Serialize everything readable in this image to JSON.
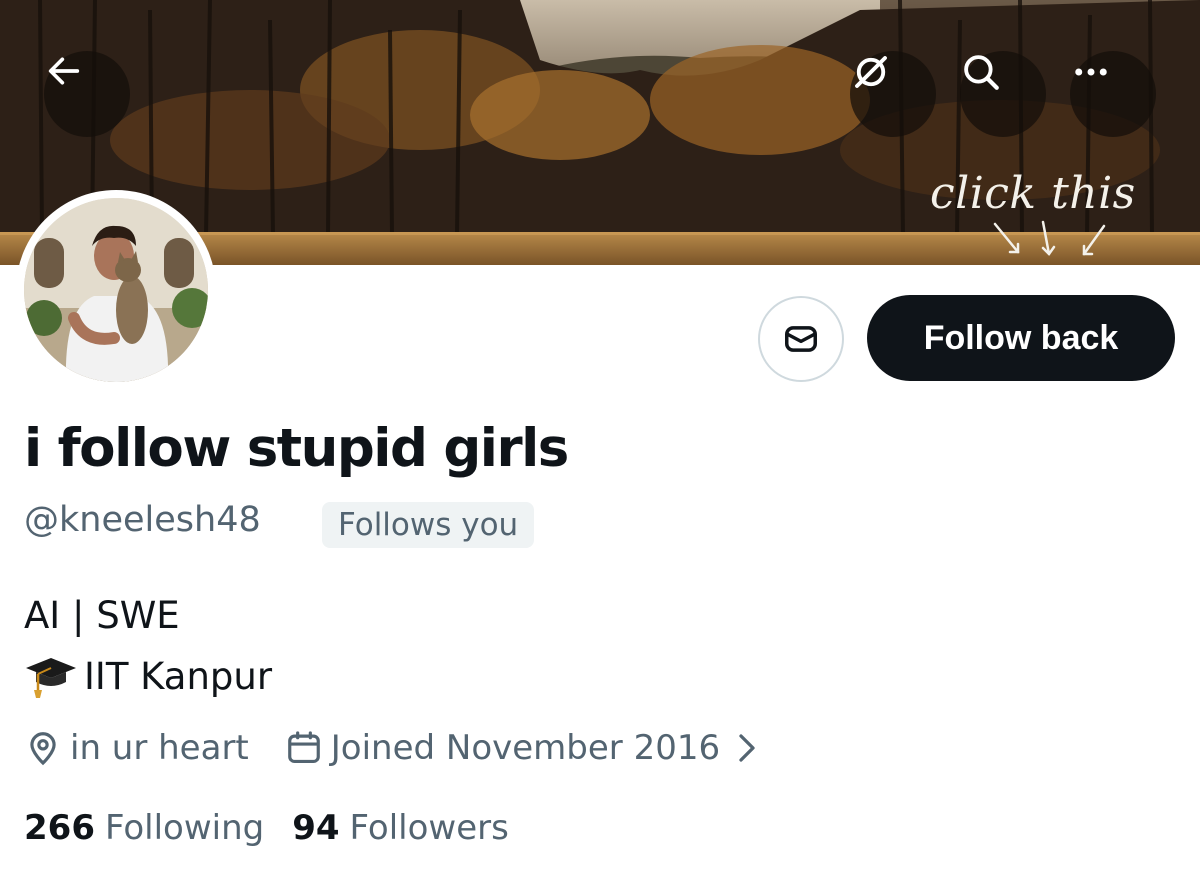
{
  "banner": {
    "overlay_text": "click this"
  },
  "toolbar": {
    "back_icon": "arrow-left-icon",
    "translate_icon": "translate-off-icon",
    "search_icon": "search-icon",
    "more_icon": "more-horizontal-icon"
  },
  "actions": {
    "message_icon": "envelope-icon",
    "follow_label": "Follow back"
  },
  "profile": {
    "display_name": "i follow stupid girls",
    "handle": "@kneelesh48",
    "follows_you_badge": "Follows you",
    "bio_line_1": "AI | SWE",
    "bio_line_2_text": "IIT Kanpur",
    "location": "in ur heart",
    "joined": "Joined November 2016"
  },
  "stats": {
    "following_count": "266",
    "following_label": "Following",
    "followers_count": "94",
    "followers_label": "Followers"
  },
  "colors": {
    "primary_text": "#0f1419",
    "secondary_text": "#536471",
    "badge_bg": "#eff3f4",
    "button_dark": "#0f1419",
    "border": "#cfd9de"
  }
}
